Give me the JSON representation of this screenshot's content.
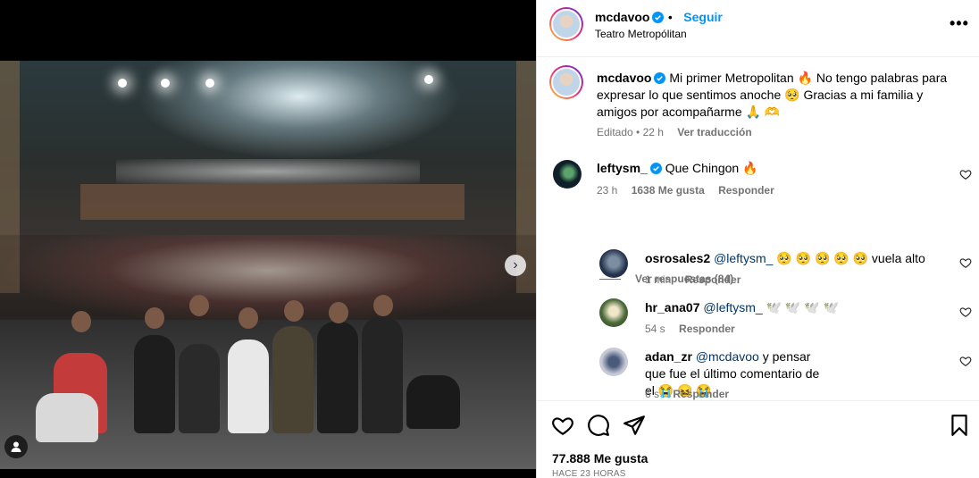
{
  "post": {
    "username": "mcdavoo",
    "follow_label": "Seguir",
    "location": "Teatro Metropólitan",
    "more_label": "•••"
  },
  "caption": {
    "username": "mcdavoo",
    "text": "Mi primer Metropolitan 🔥 No tengo palabras para expresar lo que sentimos anoche 🥺 Gracias a mi familia y amigos por acompañarme 🙏 🫶",
    "edited": "Editado",
    "time": "22 h",
    "translate": "Ver traducción"
  },
  "comments": [
    {
      "username": "leftysm_",
      "verified": true,
      "text": "Que Chingon 🔥",
      "time": "23 h",
      "likes": "1638 Me gusta",
      "reply": "Responder"
    }
  ],
  "view_replies": "Ver respuestas (84)",
  "replies": [
    {
      "username": "osrosales2",
      "mention": "@leftysm_",
      "text": "🥺 🥺 🥺 🥺 🥺 vuela alto",
      "time": "1 min",
      "reply": "Responder"
    },
    {
      "username": "hr_ana07",
      "mention": "@leftysm_",
      "text": "🕊️ 🕊️ 🕊️ 🕊️",
      "time": "54 s",
      "reply": "Responder"
    },
    {
      "username": "adan_zr",
      "mention": "@mcdavoo",
      "text": "y pensar que fue el último comentario de el 😭 😖 😭",
      "time": "6 s",
      "reply": "Responder"
    }
  ],
  "footer": {
    "likes": "77.888 Me gusta",
    "time_ago": "HACE 23 HORAS"
  },
  "icons": {
    "like": "heart-icon",
    "comment": "comment-icon",
    "share": "share-icon",
    "save": "bookmark-icon",
    "verified": "verified-badge-icon",
    "tag": "user-tag-icon",
    "next": "chevron-right-icon"
  },
  "colors": {
    "link": "#0095f6",
    "verified": "#0095f6",
    "muted": "#737373"
  }
}
